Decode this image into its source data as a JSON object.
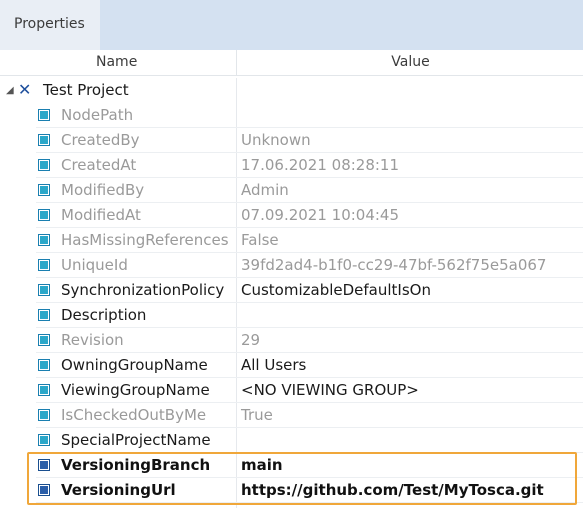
{
  "tabs": [
    {
      "label": "Properties"
    }
  ],
  "columns": {
    "name": "Name",
    "value": "Value"
  },
  "root": {
    "name": "Test Project",
    "icon": "tosca-x-icon"
  },
  "rows": [
    {
      "name": "NodePath",
      "value": "",
      "readonly": true
    },
    {
      "name": "CreatedBy",
      "value": "Unknown",
      "readonly": true
    },
    {
      "name": "CreatedAt",
      "value": "17.06.2021 08:28:11",
      "readonly": true
    },
    {
      "name": "ModifiedBy",
      "value": "Admin",
      "readonly": true
    },
    {
      "name": "ModifiedAt",
      "value": "07.09.2021 10:04:45",
      "readonly": true
    },
    {
      "name": "HasMissingReferences",
      "value": "False",
      "readonly": true
    },
    {
      "name": "UniqueId",
      "value": "39fd2ad4-b1f0-cc29-47bf-562f75e5a067",
      "readonly": true
    },
    {
      "name": "SynchronizationPolicy",
      "value": "CustomizableDefaultIsOn",
      "readonly": false
    },
    {
      "name": "Description",
      "value": "",
      "readonly": false
    },
    {
      "name": "Revision",
      "value": "29",
      "readonly": true
    },
    {
      "name": "OwningGroupName",
      "value": "All Users",
      "readonly": false
    },
    {
      "name": "ViewingGroupName",
      "value": "<NO VIEWING GROUP>",
      "readonly": false
    },
    {
      "name": "IsCheckedOutByMe",
      "value": "True",
      "readonly": true
    },
    {
      "name": "SpecialProjectName",
      "value": "",
      "readonly": false
    },
    {
      "name": "VersioningBranch",
      "value": "main",
      "readonly": false,
      "bold": true
    },
    {
      "name": "VersioningUrl",
      "value": "https://github.com/Test/MyTosca.git",
      "readonly": false,
      "bold": true
    }
  ],
  "colors": {
    "highlight": "#f0a73a",
    "tabbar": "#d4e1f1",
    "readonly_text": "#9a9a9a"
  }
}
